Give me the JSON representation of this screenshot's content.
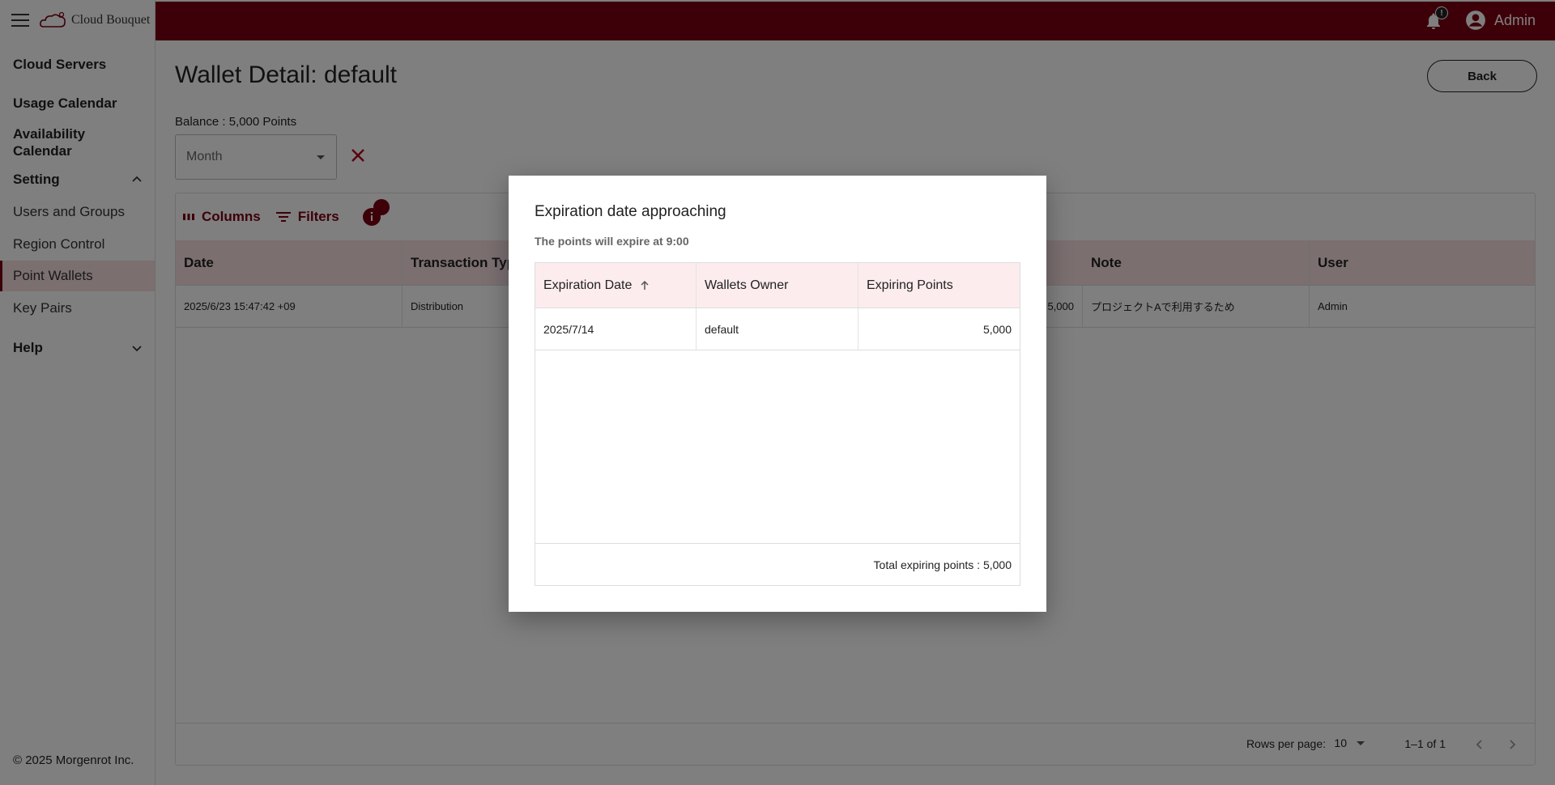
{
  "brand": {
    "name": "Cloud Bouquet"
  },
  "header": {
    "notification_badge": "!",
    "user_name": "Admin"
  },
  "sidebar": {
    "cloud_servers": "Cloud Servers",
    "usage_calendar": "Usage Calendar",
    "availability_calendar_1": "Availability",
    "availability_calendar_2": "Calendar",
    "setting": "Setting",
    "items": [
      "Users and Groups",
      "Region Control",
      "Point Wallets",
      "Key Pairs"
    ],
    "help": "Help",
    "copyright": "© 2025 Morgenrot Inc."
  },
  "main": {
    "title": "Wallet Detail: default",
    "back_label": "Back",
    "balance": "Balance : 5,000 Points",
    "month_placeholder": "Month"
  },
  "grid": {
    "toolbar": {
      "columns": "Columns",
      "filters": "Filters"
    },
    "columns": [
      "Date",
      "Transaction Typ",
      "Note",
      "User"
    ],
    "row": {
      "date": "2025/6/23 15:47:42 +09",
      "type": "Distribution",
      "points": "5,000",
      "note": "プロジェクトAで利用するため",
      "user": "Admin"
    },
    "footer": {
      "rows_per_page_label": "Rows per page:",
      "rows_per_page": "10",
      "range": "1–1 of 1"
    }
  },
  "dialog": {
    "title": "Expiration date approaching",
    "subtitle": "The points will expire at 9:00",
    "columns": [
      "Expiration Date",
      "Wallets Owner",
      "Expiring Points"
    ],
    "row": {
      "expiration_date": "2025/7/14",
      "owner": "default",
      "points": "5,000"
    },
    "total": "Total expiring points : 5,000"
  },
  "colors": {
    "brand": "#7b0012",
    "header_bg": "#f6dfe1"
  }
}
